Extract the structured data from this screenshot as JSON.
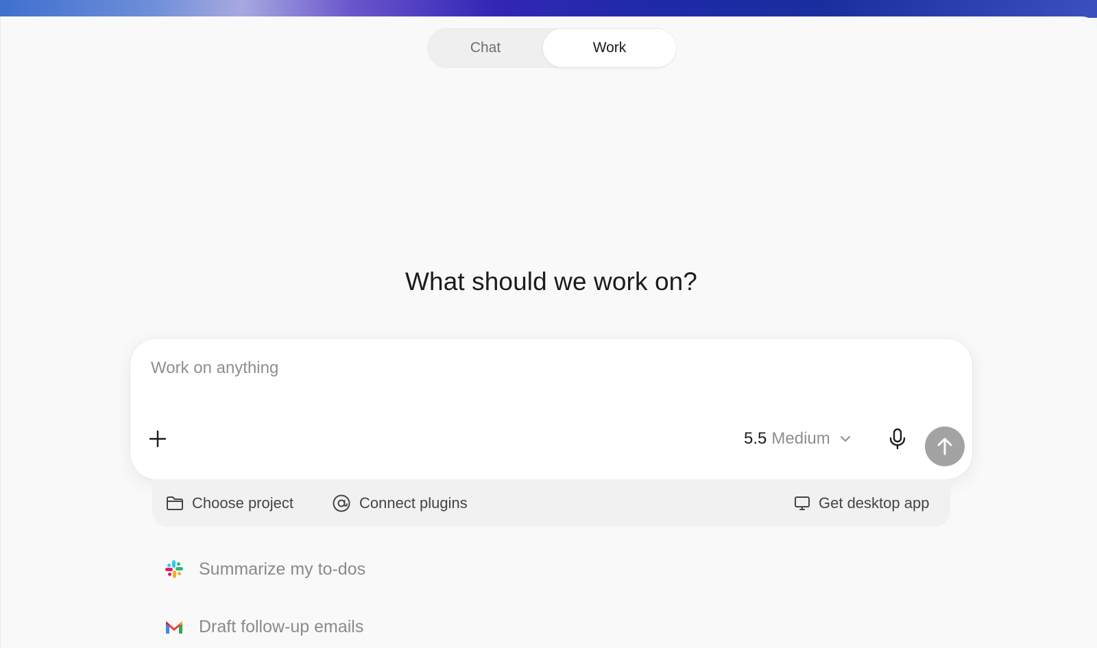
{
  "mode_switch": {
    "tabs": [
      {
        "label": "Chat",
        "selected": false
      },
      {
        "label": "Work",
        "selected": true
      }
    ]
  },
  "headline": "What should we work on?",
  "composer": {
    "placeholder": "Work on anything",
    "value": "",
    "add_icon": "plus-icon",
    "model": {
      "version": "5.5",
      "name": "Medium"
    },
    "mic_icon": "microphone-icon",
    "send_icon": "arrow-up-icon"
  },
  "actions": {
    "choose_project": "Choose project",
    "connect_plugins": "Connect plugins",
    "get_desktop_app": "Get desktop app"
  },
  "suggestions": [
    {
      "label": "Summarize my to-dos",
      "icon": "slack-logo"
    },
    {
      "label": "Draft follow-up emails",
      "icon": "gmail-logo"
    }
  ],
  "colors": {
    "send_button": "#a3a3a3",
    "background": "#f9f9f9",
    "gradient_bar": [
      "#3f6fcf",
      "#6a56cc",
      "#1e2aa8"
    ]
  }
}
